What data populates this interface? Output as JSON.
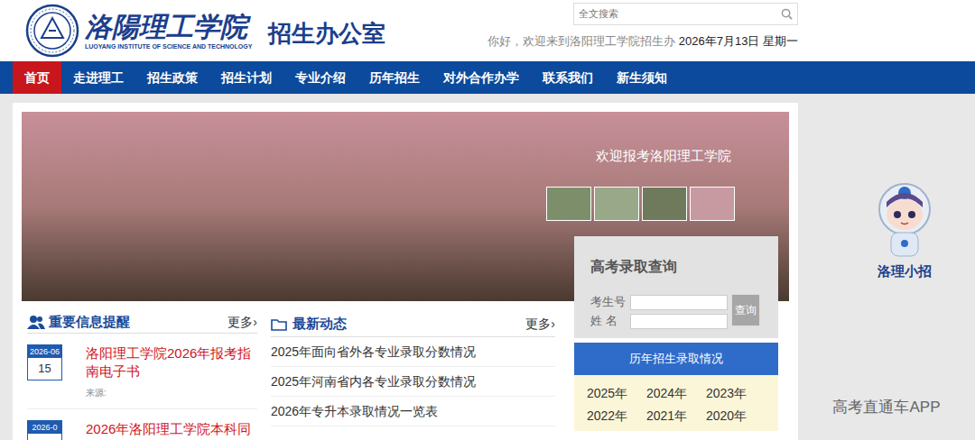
{
  "header": {
    "title": "洛陽理工学院",
    "subtitle": "LUOYANG INSTITUTE OF SCIENCE AND TECHNOLOGY",
    "office": "招生办公室",
    "search": {
      "placeholder": "全文搜索"
    },
    "greeting": "你好，欢迎来到洛阳理工学院招生办",
    "date": "2026年7月13日 星期一"
  },
  "nav": [
    {
      "label": "首页",
      "selected": true
    },
    {
      "label": "走进理工",
      "selected": false
    },
    {
      "label": "招生政策",
      "selected": false
    },
    {
      "label": "招生计划",
      "selected": false
    },
    {
      "label": "专业介绍",
      "selected": false
    },
    {
      "label": "历年招生",
      "selected": false
    },
    {
      "label": "对外合作办学",
      "selected": false
    },
    {
      "label": "联系我们",
      "selected": false
    },
    {
      "label": "新生须知",
      "selected": false
    }
  ],
  "banner": {
    "caption": "欢迎报考洛阳理工学院",
    "thumbnails": [
      {
        "color": "#7d8f6a"
      },
      {
        "color": "#9aa88a"
      },
      {
        "color": "#6f7a5c"
      },
      {
        "color": "#c79aa2"
      }
    ]
  },
  "query": {
    "title": "高考录取查询",
    "fields": [
      {
        "label": "考生号",
        "value": ""
      },
      {
        "label": "姓 名",
        "value": ""
      }
    ],
    "button": "查询"
  },
  "notices": {
    "title": "重要信息提醒",
    "more": "更多›",
    "items": [
      {
        "month": "2026-06",
        "day": "15",
        "title": "洛阳理工学院2026年报考指南电子书",
        "source": "来源:"
      },
      {
        "month": "2026-0",
        "day": "",
        "title": "2026年洛阳理工学院本科同",
        "source": ""
      }
    ]
  },
  "news": {
    "title": "最新动态",
    "more": "更多›",
    "items": [
      "2025年面向省外各专业录取分数情况",
      "2025年河南省内各专业录取分数情况",
      "2026年专升本录取情况一览表"
    ]
  },
  "history": {
    "title": "历年招生录取情况",
    "years": [
      "2025年",
      "2024年",
      "2023年",
      "2022年",
      "2021年",
      "2020年"
    ]
  },
  "mascot": {
    "label": "洛理小招"
  },
  "watermark": "高考直通车APP"
}
